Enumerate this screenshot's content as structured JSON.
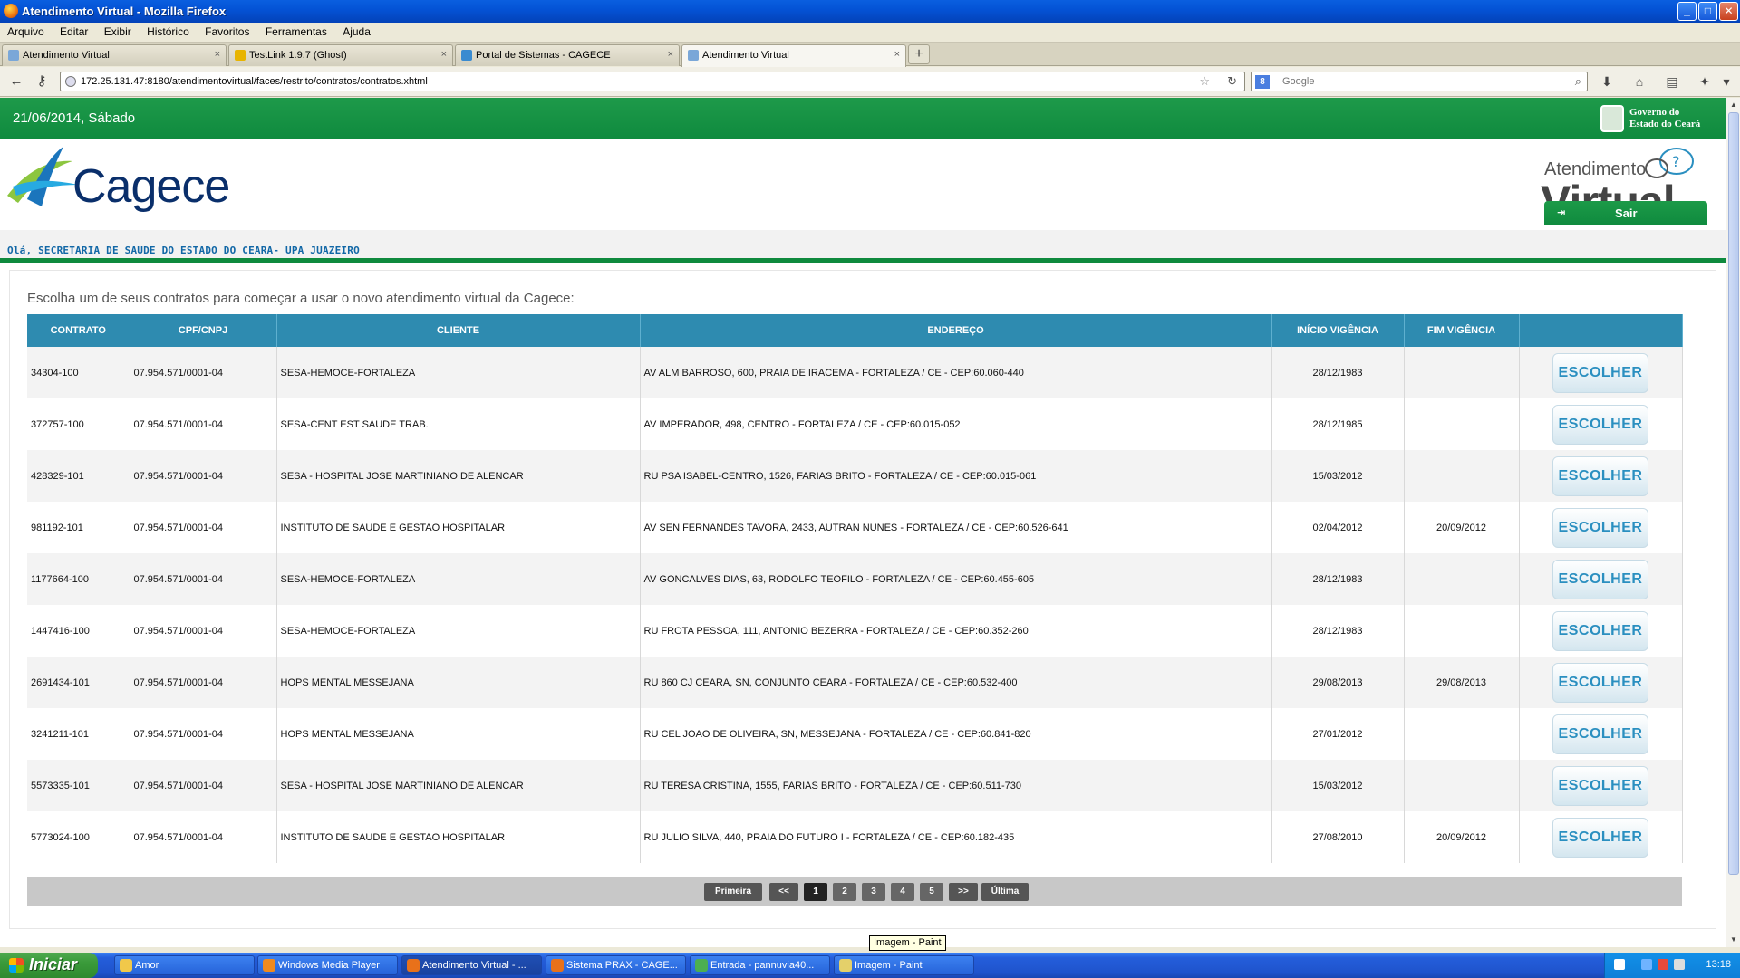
{
  "window": {
    "title": "Atendimento Virtual - Mozilla Firefox",
    "min_label": "_",
    "max_label": "□",
    "close_label": "✕"
  },
  "menu": [
    "Arquivo",
    "Editar",
    "Exibir",
    "Histórico",
    "Favoritos",
    "Ferramentas",
    "Ajuda"
  ],
  "tabs": [
    {
      "label": "Atendimento Virtual",
      "icon": "page-icon",
      "color": "#7aa7d8"
    },
    {
      "label": "TestLink 1.9.7 (Ghost)",
      "icon": "testlink-icon",
      "color": "#e8b400"
    },
    {
      "label": "Portal de Sistemas - CAGECE",
      "icon": "cagece-icon",
      "color": "#3a8bd0"
    },
    {
      "label": "Atendimento Virtual",
      "icon": "page-icon",
      "color": "#7aa7d8"
    }
  ],
  "tab_close": "×",
  "newtab_label": "+",
  "nav": {
    "url": "172.25.131.47:8180/atendimentovirtual/faces/restrito/contratos/contratos.xhtml",
    "search_placeholder": "Google",
    "back": "←",
    "key": "⚷",
    "star": "☆",
    "reload": "↻",
    "search_icon": "⌕",
    "download": "⬇",
    "home": "⌂",
    "menu": "▾"
  },
  "page": {
    "date": "21/06/2014, Sábado",
    "gov_line1": "Governo do",
    "gov_line2": "Estado do Ceará",
    "logo_text": "Cagece",
    "av_small": "Atendimento",
    "av_big": "Virtual",
    "greeting": "Olá, SECRETARIA DE SAUDE DO ESTADO DO CEARA- UPA JUAZEIRO",
    "logout": "Sair",
    "intro": "Escolha um de seus contratos para começar a usar o novo atendimento virtual da Cagece:",
    "accent": "#0f8a3e",
    "table_header_color": "#2e8bb0"
  },
  "table": {
    "headers": [
      "CONTRATO",
      "CPF/CNPJ",
      "CLIENTE",
      "ENDEREÇO",
      "INÍCIO VIGÊNCIA",
      "FIM VIGÊNCIA",
      ""
    ],
    "button_label": "ESCOLHER",
    "rows": [
      [
        "34304-100",
        "07.954.571/0001-04",
        "SESA-HEMOCE-FORTALEZA",
        "AV ALM BARROSO, 600, PRAIA DE IRACEMA - FORTALEZA / CE - CEP:60.060-440",
        "28/12/1983",
        ""
      ],
      [
        "372757-100",
        "07.954.571/0001-04",
        "SESA-CENT EST SAUDE TRAB.",
        "AV IMPERADOR, 498, CENTRO - FORTALEZA / CE - CEP:60.015-052",
        "28/12/1985",
        ""
      ],
      [
        "428329-101",
        "07.954.571/0001-04",
        "SESA - HOSPITAL JOSE MARTINIANO DE ALENCAR",
        "RU PSA ISABEL-CENTRO, 1526, FARIAS BRITO - FORTALEZA / CE - CEP:60.015-061",
        "15/03/2012",
        ""
      ],
      [
        "981192-101",
        "07.954.571/0001-04",
        "INSTITUTO DE SAUDE E GESTAO HOSPITALAR",
        "AV SEN FERNANDES TAVORA, 2433, AUTRAN NUNES - FORTALEZA / CE - CEP:60.526-641",
        "02/04/2012",
        "20/09/2012"
      ],
      [
        "1177664-100",
        "07.954.571/0001-04",
        "SESA-HEMOCE-FORTALEZA",
        "AV GONCALVES DIAS, 63, RODOLFO TEOFILO - FORTALEZA / CE - CEP:60.455-605",
        "28/12/1983",
        ""
      ],
      [
        "1447416-100",
        "07.954.571/0001-04",
        "SESA-HEMOCE-FORTALEZA",
        "RU FROTA PESSOA, 111, ANTONIO BEZERRA - FORTALEZA / CE - CEP:60.352-260",
        "28/12/1983",
        ""
      ],
      [
        "2691434-101",
        "07.954.571/0001-04",
        "HOPS MENTAL MESSEJANA",
        "RU 860 CJ CEARA, SN, CONJUNTO CEARA - FORTALEZA / CE - CEP:60.532-400",
        "29/08/2013",
        "29/08/2013"
      ],
      [
        "3241211-101",
        "07.954.571/0001-04",
        "HOPS MENTAL MESSEJANA",
        "RU CEL JOAO DE OLIVEIRA, SN, MESSEJANA - FORTALEZA / CE - CEP:60.841-820",
        "27/01/2012",
        ""
      ],
      [
        "5573335-101",
        "07.954.571/0001-04",
        "SESA - HOSPITAL JOSE MARTINIANO DE ALENCAR",
        "RU TERESA CRISTINA, 1555, FARIAS BRITO - FORTALEZA / CE - CEP:60.511-730",
        "15/03/2012",
        ""
      ],
      [
        "5773024-100",
        "07.954.571/0001-04",
        "INSTITUTO DE SAUDE E GESTAO HOSPITALAR",
        "RU JULIO SILVA, 440, PRAIA DO FUTURO I - FORTALEZA / CE - CEP:60.182-435",
        "27/08/2010",
        "20/09/2012"
      ]
    ]
  },
  "pager": {
    "first": "Primeira",
    "prev": "<<",
    "pages": [
      "1",
      "2",
      "3",
      "4",
      "5"
    ],
    "current": "1",
    "next": ">>",
    "last": "Última"
  },
  "tooltip": "Imagem - Paint",
  "taskbar": {
    "start": "Iniciar",
    "items": [
      {
        "label": "Amor",
        "icon": "folder-icon",
        "color": "#f1c84a"
      },
      {
        "label": "Windows Media Player",
        "icon": "media-player-icon",
        "color": "#f08a1e"
      },
      {
        "label": "Atendimento Virtual - ...",
        "icon": "firefox-icon",
        "color": "#e8711a"
      },
      {
        "label": "Sistema PRAX - CAGE...",
        "icon": "firefox-icon",
        "color": "#e8711a"
      },
      {
        "label": "Entrada - pannuvia40...",
        "icon": "chrome-icon",
        "color": "#4caf50"
      },
      {
        "label": "Imagem - Paint",
        "icon": "paint-icon",
        "color": "#e4d06a"
      }
    ],
    "clock": "13:18"
  }
}
